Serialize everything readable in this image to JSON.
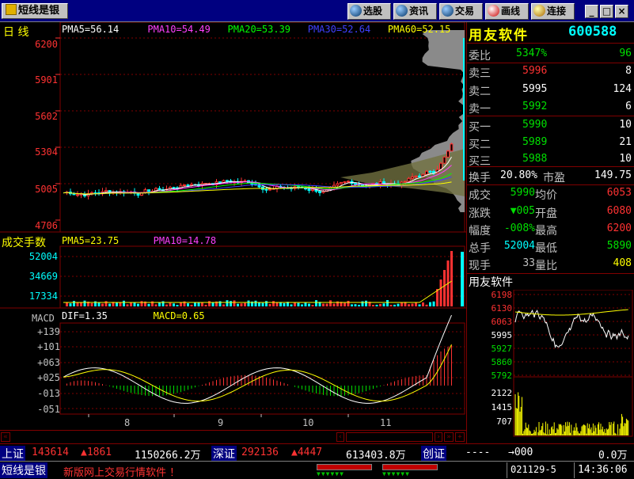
{
  "toolbar": {
    "app_label": "短线是银",
    "buttons": [
      "选股",
      "资讯",
      "交易",
      "画线",
      "连接"
    ],
    "window_controls": [
      "_",
      "□",
      "×"
    ]
  },
  "main_chart": {
    "period_label": "日 线",
    "ma_legend": [
      {
        "label": "PMA5=56.14",
        "color": "#ffffff"
      },
      {
        "label": "PMA10=54.49",
        "color": "#ff40ff"
      },
      {
        "label": "PMA20=53.39",
        "color": "#00ff00"
      },
      {
        "label": "PMA30=52.64",
        "color": "#4040ff"
      },
      {
        "label": "PMA60=52.15",
        "color": "#ffff00"
      }
    ],
    "y_ticks": [
      "6200",
      "5901",
      "5602",
      "5304",
      "5005",
      "4706"
    ]
  },
  "volume_chart": {
    "title": "成交手数",
    "legend": [
      {
        "label": "PMA5=23.75",
        "color": "#ffff00"
      },
      {
        "label": "PMA10=14.78",
        "color": "#ff40ff"
      }
    ],
    "y_ticks": [
      "52004",
      "34669",
      "17334"
    ]
  },
  "macd_chart": {
    "title": "MACD",
    "legend": [
      {
        "label": "DIF=1.35",
        "color": "#ffffff"
      },
      {
        "label": "MACD=0.65",
        "color": "#ffff00"
      }
    ],
    "y_ticks": [
      "+139",
      "+101",
      "+063",
      "+025",
      "-013",
      "-051"
    ],
    "x_ticks": [
      "8",
      "9",
      "10",
      "11"
    ]
  },
  "quote": {
    "name": "用友软件",
    "code": "600588",
    "webi_label": "委比",
    "webi_value": "5347%",
    "webi_diff": "96",
    "asks": [
      {
        "label": "卖三",
        "price": "5996",
        "vol": "8"
      },
      {
        "label": "卖二",
        "price": "5995",
        "vol": "124"
      },
      {
        "label": "卖一",
        "price": "5992",
        "vol": "6"
      }
    ],
    "bids": [
      {
        "label": "买一",
        "price": "5990",
        "vol": "10"
      },
      {
        "label": "买二",
        "price": "5989",
        "vol": "21"
      },
      {
        "label": "买三",
        "price": "5988",
        "vol": "10"
      }
    ],
    "turnover_label": "换手",
    "turnover": "20.80%",
    "pe_label": "市盈",
    "pe": "149.75",
    "stats": [
      {
        "l1": "成交",
        "v1": "5990",
        "c1": "#00e000",
        "l2": "均价",
        "v2": "6053",
        "c2": "#ff3232"
      },
      {
        "l1": "涨跌",
        "v1": "▼005",
        "c1": "#00e000",
        "l2": "开盘",
        "v2": "6080",
        "c2": "#ff3232"
      },
      {
        "l1": "幅度",
        "v1": "-008%",
        "c1": "#00e000",
        "l2": "最高",
        "v2": "6200",
        "c2": "#ff3232"
      },
      {
        "l1": "总手",
        "v1": "52004",
        "c1": "#00ffff",
        "l2": "最低",
        "v2": "5890",
        "c2": "#00e000"
      },
      {
        "l1": "现手",
        "v1": "33",
        "c1": "#c0c0c0",
        "l2": "量比",
        "v2": "408",
        "c2": "#ffff00"
      }
    ]
  },
  "mini_chart": {
    "title": "用友软件",
    "price_ticks": [
      "6198",
      "6130",
      "6063",
      "5995",
      "5927",
      "5860",
      "5792"
    ],
    "vol_ticks": [
      "2122",
      "1415",
      "707"
    ]
  },
  "index_bar": {
    "sh_label": "上证",
    "sh_value": "143614",
    "sh_change": "▲1861",
    "sh_amount": "1150266.2万",
    "sz_label": "深证",
    "sz_value": "292136",
    "sz_change": "▲4447",
    "sz_amount": "613403.8万",
    "cy_label": "创证",
    "cy_value": "----",
    "cy_change": "→000",
    "cy_amount": "0.0万"
  },
  "status_bar": {
    "app_label": "短线是银",
    "marquee": "新版网上交易行情软件 ！",
    "date": "021129-5",
    "time": "14:36:06"
  }
}
